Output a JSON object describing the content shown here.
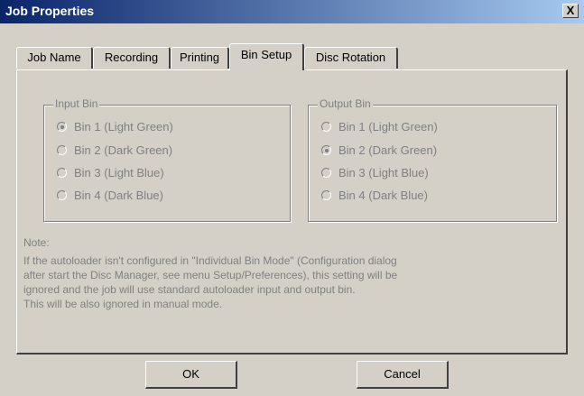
{
  "window": {
    "title": "Job Properties",
    "close_label": "X"
  },
  "tabs": [
    {
      "label": "Job Name"
    },
    {
      "label": "Recording"
    },
    {
      "label": "Printing"
    },
    {
      "label": "Bin Setup",
      "active": true
    },
    {
      "label": "Disc Rotation"
    }
  ],
  "input_bin": {
    "legend": "Input Bin",
    "options": [
      {
        "label": "Bin 1 (Light Green)",
        "checked": true
      },
      {
        "label": "Bin 2 (Dark Green)",
        "checked": false
      },
      {
        "label": "Bin 3 (Light Blue)",
        "checked": false
      },
      {
        "label": "Bin 4 (Dark Blue)",
        "checked": false
      }
    ]
  },
  "output_bin": {
    "legend": "Output Bin",
    "options": [
      {
        "label": "Bin 1 (Light Green)",
        "checked": false
      },
      {
        "label": "Bin 2 (Dark Green)",
        "checked": true
      },
      {
        "label": "Bin 3 (Light Blue)",
        "checked": false
      },
      {
        "label": "Bin 4 (Dark Blue)",
        "checked": false
      }
    ]
  },
  "note": {
    "heading": "Note:",
    "lines": [
      "If the autoloader isn't configured in \"Individual Bin Mode\" (Configuration dialog",
      "after start the Disc Manager, see menu Setup/Preferences), this setting will be",
      "ignored and the job will use standard autoloader input and output bin.",
      "This will be also ignored in manual mode."
    ]
  },
  "buttons": {
    "ok": "OK",
    "cancel": "Cancel"
  },
  "colors": {
    "titlebar_start": "#0a246a",
    "titlebar_end": "#a6caf0",
    "face": "#d4d0c8",
    "disabled_text": "#808080"
  }
}
